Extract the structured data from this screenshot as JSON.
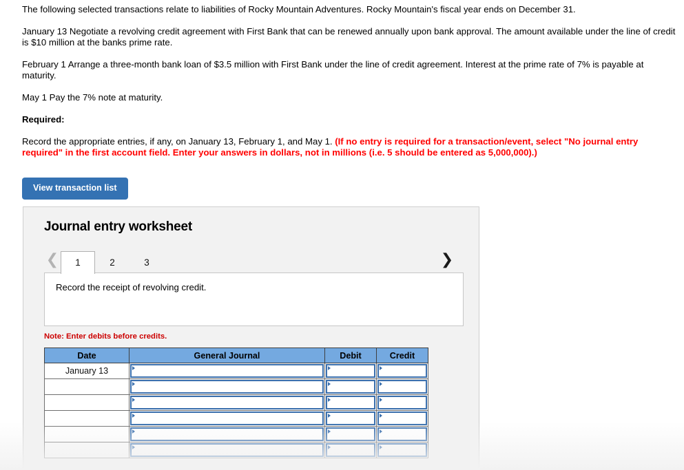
{
  "problem": {
    "intro": "The following selected transactions relate to liabilities of Rocky Mountain Adventures. Rocky Mountain's fiscal year ends on December 31.",
    "transaction_jan": "January 13 Negotiate a revolving credit agreement with First Bank that can be renewed annually upon bank approval. The amount available under the line of credit is $10 million at the banks prime rate.",
    "transaction_feb": "February 1 Arrange a three-month bank loan of $3.5 million with First Bank under the line of credit agreement. Interest at the prime rate of 7% is payable at maturity.",
    "transaction_may": "May 1 Pay the 7% note at maturity.",
    "required_label": "Required:",
    "required_plain": "Record the appropriate entries, if any, on January 13, February 1, and May 1. ",
    "required_emphasis": "(If no entry is required for a transaction/event, select \"No journal entry required\" in the first account field. Enter your answers in dollars, not in millions (i.e. 5 should be entered as 5,000,000).)"
  },
  "toolbar": {
    "view_transaction_list_label": "View transaction list"
  },
  "worksheet": {
    "title": "Journal entry worksheet",
    "prev_icon": "chevron-left-icon",
    "next_icon": "chevron-right-icon",
    "tabs": [
      {
        "label": "1",
        "active": true
      },
      {
        "label": "2",
        "active": false
      },
      {
        "label": "3",
        "active": false
      }
    ],
    "description": "Record the receipt of revolving credit.",
    "note": "Note: Enter debits before credits.",
    "table": {
      "columns": [
        "Date",
        "General Journal",
        "Debit",
        "Credit"
      ],
      "rows": [
        {
          "date": "January 13",
          "general_journal": "",
          "debit": "",
          "credit": ""
        },
        {
          "date": "",
          "general_journal": "",
          "debit": "",
          "credit": ""
        },
        {
          "date": "",
          "general_journal": "",
          "debit": "",
          "credit": ""
        },
        {
          "date": "",
          "general_journal": "",
          "debit": "",
          "credit": ""
        },
        {
          "date": "",
          "general_journal": "",
          "debit": "",
          "credit": ""
        },
        {
          "date": "",
          "general_journal": "",
          "debit": "",
          "credit": ""
        }
      ]
    }
  },
  "colors": {
    "button_blue": "#3472b3",
    "header_blue": "#74a9e0",
    "cell_border_blue": "#3a6fad",
    "alert_red": "#ff0000",
    "note_red": "#cc0000",
    "panel_gray": "#f2f2f2"
  }
}
